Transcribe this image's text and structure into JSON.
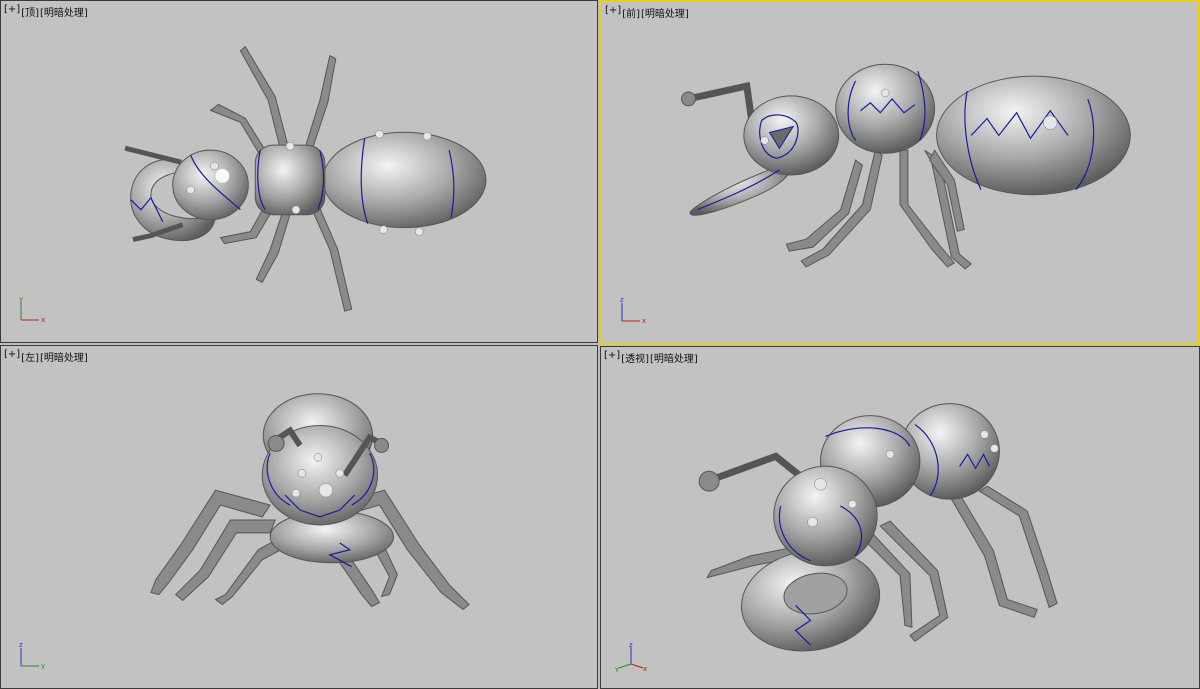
{
  "viewports": {
    "top": {
      "plus": "[+]",
      "view": "[顶]",
      "shading": "[明暗处理]",
      "axes": [
        "y",
        "x"
      ]
    },
    "front": {
      "plus": "[+]",
      "view": "[前]",
      "shading": "[明暗处理]",
      "axes": [
        "z",
        "x"
      ]
    },
    "left": {
      "plus": "[+]",
      "view": "[左]",
      "shading": "[明暗处理]",
      "axes": [
        "z",
        "y"
      ]
    },
    "persp": {
      "plus": "[+]",
      "view": "[透视]",
      "shading": "[明暗处理]",
      "axes": [
        "z",
        "y",
        "x"
      ]
    }
  },
  "active_viewport": "front",
  "colors": {
    "viewport_bg": "#c2c2c2",
    "active_border": "#e6d11a",
    "mesh": "#8c8c8c",
    "seam": "#1a1aa0"
  }
}
